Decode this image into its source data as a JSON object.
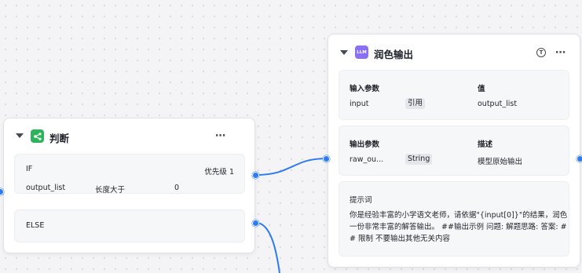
{
  "colors": {
    "accent_blue": "#2f7bf0",
    "condition_icon_bg": "#2db45a",
    "llm_icon_bg": "#8b6ff5"
  },
  "condition_node": {
    "title": "判断",
    "icon": "branch-icon",
    "more_label": "⋯",
    "if_branch": {
      "keyword": "IF",
      "priority": "优先级 1",
      "variable": "output_list",
      "operator": "长度大于",
      "value": "0"
    },
    "else_branch": {
      "keyword": "ELSE"
    }
  },
  "llm_node": {
    "title": "润色输出",
    "icon_label": "LLM",
    "more_label": "⋯",
    "tool_icon_label": "T",
    "inputs": {
      "header_name": "输入参数",
      "header_value": "值",
      "rows": [
        {
          "name": "input",
          "type": "引用",
          "value": "output_list"
        }
      ]
    },
    "outputs": {
      "header_name": "输出参数",
      "header_desc": "描述",
      "rows": [
        {
          "name": "raw_ou...",
          "type": "String",
          "desc": "模型原始输出"
        }
      ]
    },
    "prompt": {
      "header": "提示词",
      "text": "你是经验丰富的小学语文老师，请依据\"{input[0]}\"的结果，润色一份非常丰富的解答输出。 ##输出示例 问题: 解题思路: 答案: ## 限制 不要输出其他无关内容"
    }
  }
}
